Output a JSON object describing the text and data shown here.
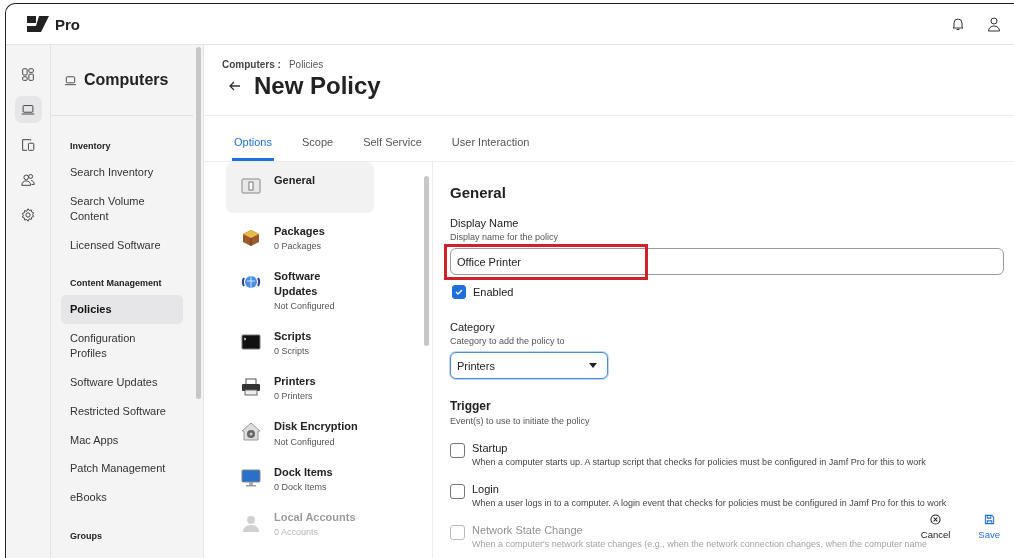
{
  "topbar": {
    "brand": "Pro",
    "actions": [
      {
        "kind": "bell"
      },
      {
        "kind": "user"
      }
    ]
  },
  "rail": [
    {
      "kind": "dashboard",
      "selected": false
    },
    {
      "kind": "computer",
      "selected": true
    },
    {
      "kind": "devices",
      "selected": false
    },
    {
      "kind": "users",
      "selected": false
    },
    {
      "kind": "settings",
      "selected": false
    }
  ],
  "sidebar": {
    "title": "Computers",
    "sections": [
      {
        "heading": "Inventory",
        "items": [
          {
            "label": "Search Inventory",
            "selected": false
          },
          {
            "label": "Search Volume Content",
            "selected": false
          },
          {
            "label": "Licensed Software",
            "selected": false
          }
        ]
      },
      {
        "heading": "Content Management",
        "items": [
          {
            "label": "Policies",
            "selected": true
          },
          {
            "label": "Configuration Profiles",
            "selected": false
          },
          {
            "label": "Software Updates",
            "selected": false
          },
          {
            "label": "Restricted Software",
            "selected": false
          },
          {
            "label": "Mac Apps",
            "selected": false
          },
          {
            "label": "Patch Management",
            "selected": false
          },
          {
            "label": "eBooks",
            "selected": false
          }
        ]
      },
      {
        "heading": "Groups"
      }
    ]
  },
  "breadcrumb": {
    "parent": "Computers :",
    "current": "Policies"
  },
  "title": "New Policy",
  "tabs": [
    {
      "label": "Options",
      "selected": true
    },
    {
      "label": "Scope",
      "selected": false
    },
    {
      "label": "Self Service",
      "selected": false
    },
    {
      "label": "User Interaction",
      "selected": false
    }
  ],
  "payloads": [
    {
      "kind": "general",
      "name": "General",
      "selected": true,
      "faded": false
    },
    {
      "kind": "packages",
      "name": "Packages",
      "summary": "0 Packages",
      "selected": false,
      "faded": false
    },
    {
      "kind": "software-updates",
      "name": "Software Updates",
      "summary": "Not Configured",
      "selected": false,
      "faded": false
    },
    {
      "kind": "scripts",
      "name": "Scripts",
      "summary": "0 Scripts",
      "selected": false,
      "faded": false
    },
    {
      "kind": "printers",
      "name": "Printers",
      "summary": "0 Printers",
      "selected": false,
      "faded": false
    },
    {
      "kind": "disk-encryption",
      "name": "Disk Encryption",
      "summary": "Not Configured",
      "selected": false,
      "faded": false
    },
    {
      "kind": "dock-items",
      "name": "Dock Items",
      "summary": "0 Dock Items",
      "selected": false,
      "faded": false
    },
    {
      "kind": "local-accounts",
      "name": "Local Accounts",
      "summary": "0 Accounts",
      "selected": false,
      "faded": true
    }
  ],
  "form": {
    "heading": "General",
    "display_name": {
      "label": "Display Name",
      "help": "Display name for the policy",
      "value": "Office Printer",
      "highlighted": true
    },
    "enabled": {
      "label": "Enabled",
      "checked": true
    },
    "category": {
      "label": "Category",
      "help": "Category to add the policy to",
      "value": "Printers"
    },
    "trigger": {
      "heading": "Trigger",
      "help": "Event(s) to use to initiate the policy",
      "options": [
        {
          "label": "Startup",
          "description": "When a computer starts up. A startup script that checks for policies must be configured in Jamf Pro for this to work",
          "checked": false,
          "faded": false
        },
        {
          "label": "Login",
          "description": "When a user logs in to a computer. A login event that checks for policies must be configured in Jamf Pro for this to work",
          "checked": false,
          "faded": false
        },
        {
          "label": "Network State Change",
          "description": "When a computer's network state changes (e.g., when the network connection changes, when the computer name",
          "checked": false,
          "faded": true
        }
      ]
    }
  },
  "actions": [
    {
      "kind": "cancel",
      "label": "Cancel"
    },
    {
      "kind": "save",
      "label": "Save"
    }
  ]
}
